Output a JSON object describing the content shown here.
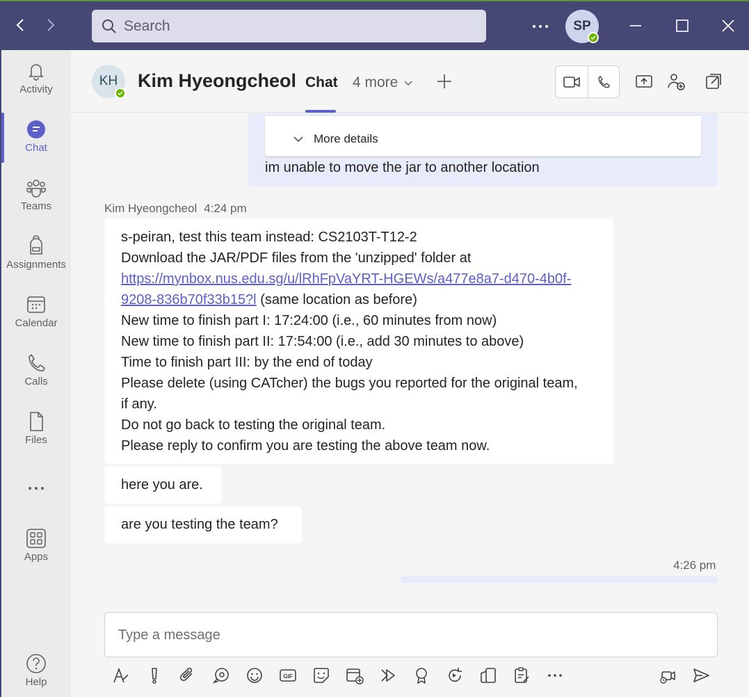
{
  "titlebar": {
    "search_placeholder": "Search",
    "user_initials": "SP",
    "colors": {
      "bar": "#464775",
      "accent": "#5b5fc7",
      "presence": "#6bb700"
    }
  },
  "rail": {
    "items": [
      {
        "label": "Activity",
        "icon": "bell-icon"
      },
      {
        "label": "Chat",
        "icon": "chat-icon",
        "active": true
      },
      {
        "label": "Teams",
        "icon": "teams-icon"
      },
      {
        "label": "Assignments",
        "icon": "backpack-icon"
      },
      {
        "label": "Calendar",
        "icon": "calendar-icon"
      },
      {
        "label": "Calls",
        "icon": "phone-icon"
      },
      {
        "label": "Files",
        "icon": "file-icon"
      },
      {
        "label": "...",
        "icon": "more-icon"
      },
      {
        "label": "Apps",
        "icon": "apps-icon"
      }
    ],
    "help_label": "Help"
  },
  "header": {
    "contact_initials": "KH",
    "contact_name": "Kim Hyeongcheol",
    "tab_active": "Chat",
    "tab_more": "4 more"
  },
  "chat": {
    "card_expand_label": "More details",
    "my_message": "im unable to move the jar to another location",
    "sender": "Kim Hyeongcheol",
    "sender_time": "4:24 pm",
    "main_message": {
      "line1": "s-peiran, test this team instead: CS2103T-T12-2",
      "line2": "Download the JAR/PDF files from the 'unzipped' folder at",
      "link_part1": "https://mynbox.nus.edu.sg/u/lRhFpVaYRT-HGEWs/a477e8a7-d470-4b0f-",
      "link_part2": "9208-836b70f33b15?l",
      "link_suffix": " (same location as before)",
      "line5": "New time to finish part I: 17:24:00 (i.e., 60 minutes from now)",
      "line6": "New time to finish part II: 17:54:00 (i.e., add 30 minutes to above)",
      "line7": "Time to finish part III: by the end of today",
      "line8": "Please delete (using CATcher) the bugs you reported for the original team,",
      "line9": "if any.",
      "line10": "Do not go back to testing the original team.",
      "line11": "Please reply to confirm you are testing the above team now."
    },
    "message2": "here you are.",
    "message3": "are you testing the team?",
    "my_time": "4:26 pm"
  },
  "compose": {
    "placeholder": "Type a message"
  }
}
